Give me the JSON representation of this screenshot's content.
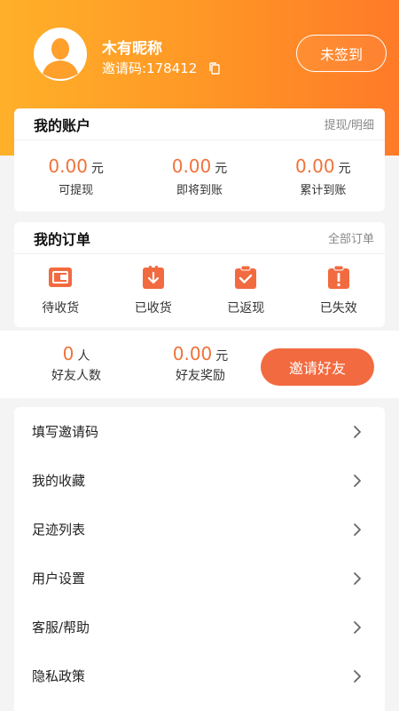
{
  "profile": {
    "nickname": "木有昵称",
    "invite_code": "邀请码:178412",
    "signin_label": "未签到"
  },
  "account": {
    "title": "我的账户",
    "link": "提现/明细",
    "items": [
      {
        "amount": "0.00",
        "unit": "元",
        "label": "可提现"
      },
      {
        "amount": "0.00",
        "unit": "元",
        "label": "即将到账"
      },
      {
        "amount": "0.00",
        "unit": "元",
        "label": "累计到账"
      }
    ]
  },
  "orders": {
    "title": "我的订单",
    "link": "全部订单",
    "items": [
      {
        "label": "待收货",
        "icon": "wallet-icon"
      },
      {
        "label": "已收货",
        "icon": "download-icon"
      },
      {
        "label": "已返现",
        "icon": "check-clipboard-icon"
      },
      {
        "label": "已失效",
        "icon": "alert-icon"
      }
    ]
  },
  "friends": {
    "count": "0",
    "count_unit": "人",
    "count_label": "好友人数",
    "reward": "0.00",
    "reward_unit": "元",
    "reward_label": "好友奖励",
    "invite_button": "邀请好友"
  },
  "menu": [
    {
      "label": "填写邀请码"
    },
    {
      "label": "我的收藏"
    },
    {
      "label": "足迹列表"
    },
    {
      "label": "用户设置"
    },
    {
      "label": "客服/帮助"
    },
    {
      "label": "隐私政策"
    }
  ],
  "colors": {
    "accent": "#f26a3f",
    "amount": "#f0723a",
    "header_start": "#ffb02a",
    "header_end": "#ff7a28"
  }
}
